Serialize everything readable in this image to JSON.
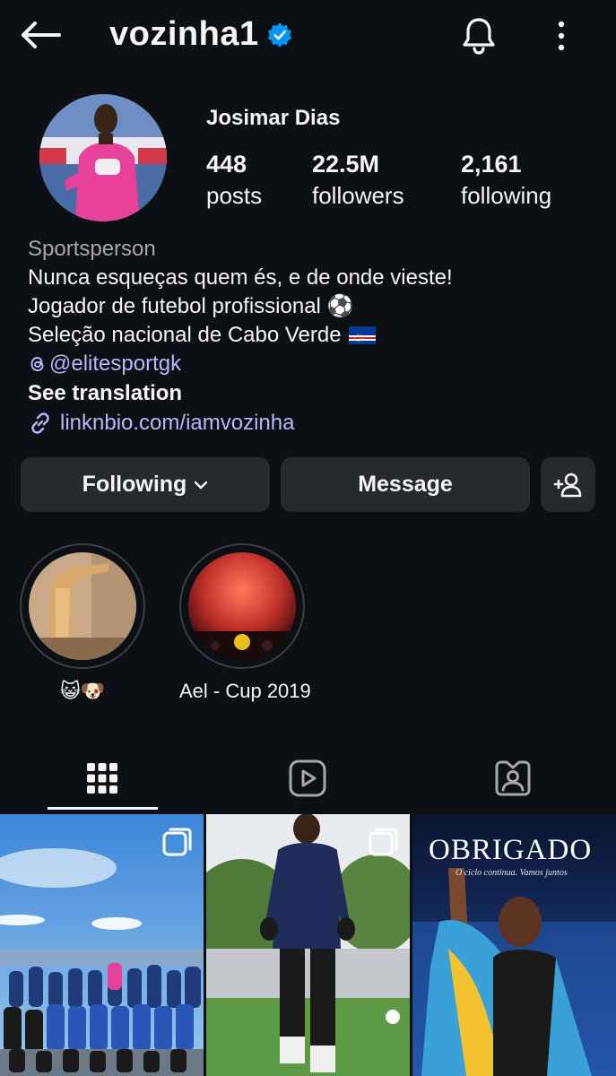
{
  "header": {
    "username": "vozinha1",
    "icons": {
      "back": "arrow-left-icon",
      "verified": "verified-badge-icon",
      "notifications": "bell-icon",
      "more": "more-vertical-icon"
    }
  },
  "profile": {
    "full_name": "Josimar Dias",
    "stats": [
      {
        "value": "448",
        "label": "posts"
      },
      {
        "value": "22.5M",
        "label": "followers"
      },
      {
        "value": "2,161",
        "label": "following"
      }
    ],
    "category": "Sportsperson",
    "bio_lines": [
      "Nunca esqueças quem és, e de onde vieste!",
      "Jogador de futebol profissional ⚽",
      "Seleção nacional de Cabo Verde"
    ],
    "threads_handle": "@elitesportgk",
    "see_translation": "See translation",
    "link": "linknbio.com/iamvozinha"
  },
  "actions": {
    "following_label": "Following",
    "message_label": "Message"
  },
  "highlights": [
    {
      "label": "😺🐶"
    },
    {
      "label": "Ael - Cup 2019"
    }
  ],
  "tabs": [
    {
      "icon": "grid-icon",
      "active": true
    },
    {
      "icon": "reels-icon",
      "active": false
    },
    {
      "icon": "tagged-icon",
      "active": false
    }
  ],
  "posts": [
    {
      "multi": true
    },
    {
      "multi": true
    },
    {
      "title_text": "OBRIGADO",
      "subtitle_text": "O ciclo continua. Vamos juntos"
    }
  ],
  "colors": {
    "background": "#0c1014",
    "button": "#262a2f",
    "link": "#b4b9ff",
    "verified": "#0095f6",
    "muted": "#a8a8a8"
  }
}
